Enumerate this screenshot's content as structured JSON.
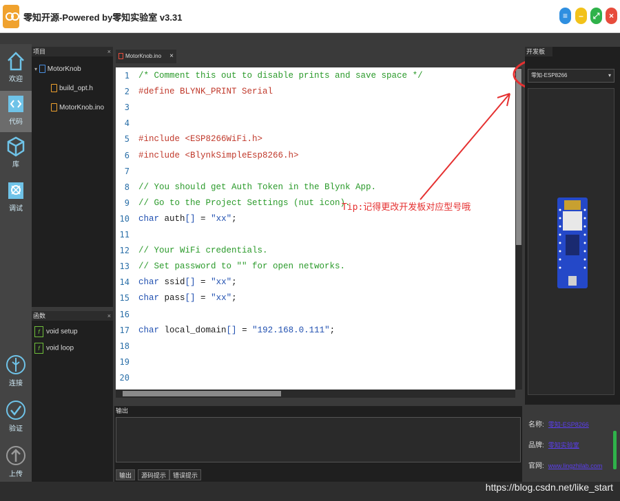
{
  "window": {
    "title": "零知开源-Powered by零知实验室 v3.31"
  },
  "titlebar_buttons": [
    {
      "name": "menu",
      "glyph": "≡",
      "color": "#2f8fe0"
    },
    {
      "name": "minimize",
      "glyph": "–",
      "color": "#f2c21a"
    },
    {
      "name": "maximize",
      "glyph": "⤢",
      "color": "#2fb24a"
    },
    {
      "name": "close",
      "glyph": "×",
      "color": "#e74c3c"
    }
  ],
  "sidebar": {
    "items": [
      {
        "label": "欢迎",
        "icon": "home-icon"
      },
      {
        "label": "代码",
        "icon": "code-icon"
      },
      {
        "label": "库",
        "icon": "cube-icon"
      },
      {
        "label": "调试",
        "icon": "bug-icon"
      },
      {
        "label": "连接",
        "icon": "usb-icon"
      },
      {
        "label": "验证",
        "icon": "check-icon"
      },
      {
        "label": "上传",
        "icon": "upload-icon"
      }
    ]
  },
  "project_panel": {
    "title": "项目",
    "close_glyph": "×",
    "root": "MotorKnob",
    "files": [
      "build_opt.h",
      "MotorKnob.ino"
    ]
  },
  "functions_panel": {
    "title": "函数",
    "close_glyph": "×",
    "fn_glyph": "f",
    "items": [
      "void setup",
      "void loop"
    ]
  },
  "editor": {
    "tab_label": "MotorKnob.ino",
    "tab_close": "×",
    "line_numbers": [
      "1",
      "2",
      "3",
      "4",
      "5",
      "6",
      "7",
      "8",
      "9",
      "10",
      "11",
      "12",
      "13",
      "14",
      "15",
      "16",
      "17",
      "18",
      "19",
      "20"
    ],
    "lines": [
      {
        "text": "/* Comment this out to disable prints and save space */",
        "kind": "cm"
      },
      {
        "text": "#define BLYNK_PRINT Serial",
        "kind": "pp"
      },
      {
        "text": "",
        "kind": ""
      },
      {
        "text": "",
        "kind": ""
      },
      {
        "text": "#include <ESP8266WiFi.h>",
        "kind": "pp"
      },
      {
        "text": "#include <BlynkSimpleEsp8266.h>",
        "kind": "pp"
      },
      {
        "text": "",
        "kind": ""
      },
      {
        "text": "// You should get Auth Token in the Blynk App.",
        "kind": "cm"
      },
      {
        "text": "// Go to the Project Settings (nut icon).",
        "kind": "cm"
      },
      {
        "text": "char auth[] = \"xx\";",
        "kind": "decl"
      },
      {
        "text": "",
        "kind": ""
      },
      {
        "text": "// Your WiFi credentials.",
        "kind": "cm"
      },
      {
        "text": "// Set password to \"\" for open networks.",
        "kind": "cm"
      },
      {
        "text": "char ssid[] = \"xx\";",
        "kind": "decl"
      },
      {
        "text": "char pass[] = \"xx\";",
        "kind": "decl"
      },
      {
        "text": "",
        "kind": ""
      },
      {
        "text": "char local_domain[] = \"192.168.0.111\";",
        "kind": "decl"
      },
      {
        "text": "",
        "kind": ""
      },
      {
        "text": "",
        "kind": ""
      },
      {
        "text": "",
        "kind": ""
      }
    ]
  },
  "annotation": {
    "tip": "Tip:记得更改开发板对应型号哦",
    "color": "#e53030"
  },
  "output_panel": {
    "title": "输出",
    "tabs": [
      "输出",
      "源码提示",
      "错误提示"
    ]
  },
  "board_panel": {
    "title": "开发板",
    "selected": "零知-ESP8266",
    "select_arrow": "▾",
    "info": [
      {
        "label": "名称:",
        "value": "零知-ESP8266"
      },
      {
        "label": "品牌:",
        "value": "零知实验室"
      },
      {
        "label": "官网:",
        "value": "www.lingzhilab.com"
      }
    ]
  },
  "watermark": "https://blog.csdn.net/like_start"
}
